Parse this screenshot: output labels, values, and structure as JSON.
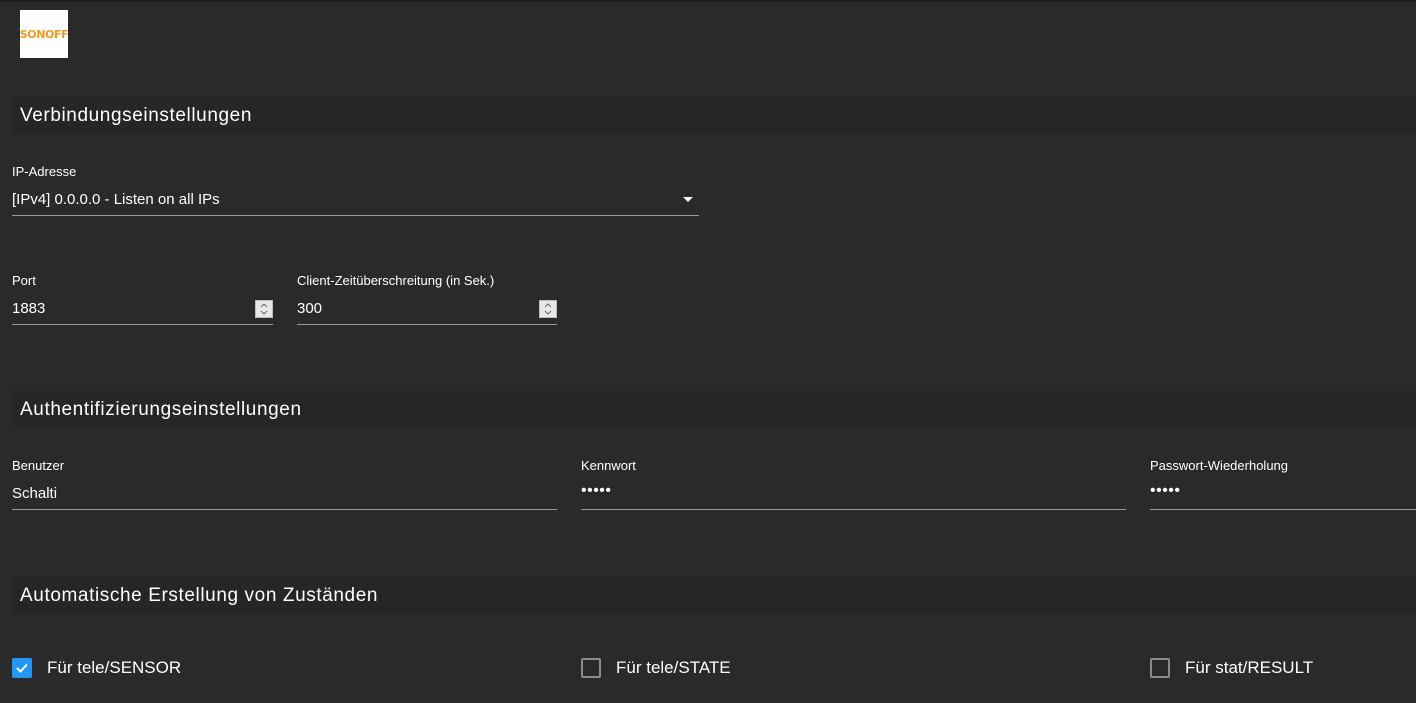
{
  "logo": {
    "text": "SONOFF"
  },
  "sections": {
    "connection": {
      "title": "Verbindungseinstellungen"
    },
    "auth": {
      "title": "Authentifizierungseinstellungen"
    },
    "auto": {
      "title": "Automatische Erstellung von Zuständen"
    }
  },
  "fields": {
    "ip": {
      "label": "IP-Adresse",
      "value": "[IPv4] 0.0.0.0 - Listen on all IPs"
    },
    "port": {
      "label": "Port",
      "value": "1883"
    },
    "timeout": {
      "label": "Client-Zeitüberschreitung (in Sek.)",
      "value": "300"
    },
    "user": {
      "label": "Benutzer",
      "value": "Schalti"
    },
    "password": {
      "label": "Kennwort",
      "value": "•••••"
    },
    "password_repeat": {
      "label": "Passwort-Wiederholung",
      "value": "•••••"
    }
  },
  "checkboxes": [
    {
      "label": "Für tele/SENSOR",
      "checked": true
    },
    {
      "label": "Für tele/STATE",
      "checked": false
    },
    {
      "label": "Für stat/RESULT",
      "checked": false
    }
  ],
  "colors": {
    "background": "#2a2a2a",
    "section_header": "#262626",
    "accent": "#2196f3",
    "logo_orange": "#f29a1f"
  }
}
